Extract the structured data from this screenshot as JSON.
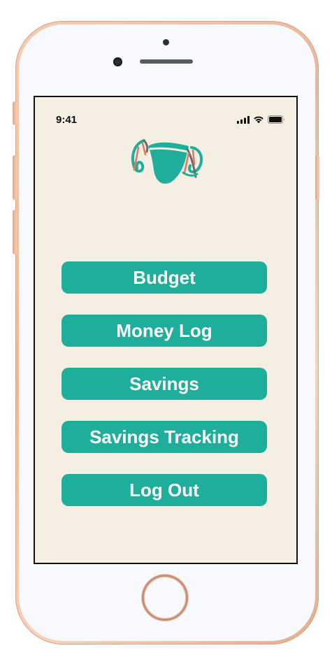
{
  "status_bar": {
    "time": "9:41",
    "icons": [
      "signal-icon",
      "wifi-icon",
      "battery-icon"
    ]
  },
  "logo": {
    "icon": "app-logo-icon",
    "colors": {
      "teal": "#1fae9b",
      "accent": "#e2765e",
      "outline": "#6b6b6b"
    }
  },
  "menu": {
    "items": [
      {
        "label": "Budget"
      },
      {
        "label": "Money Log"
      },
      {
        "label": "Savings"
      },
      {
        "label": "Savings Tracking"
      },
      {
        "label": "Log Out"
      }
    ]
  },
  "theme": {
    "screen_background": "#f5eee3",
    "button_color": "#1fae9b",
    "button_text": "#ffffff",
    "device_frame": "#f0c2a8"
  }
}
